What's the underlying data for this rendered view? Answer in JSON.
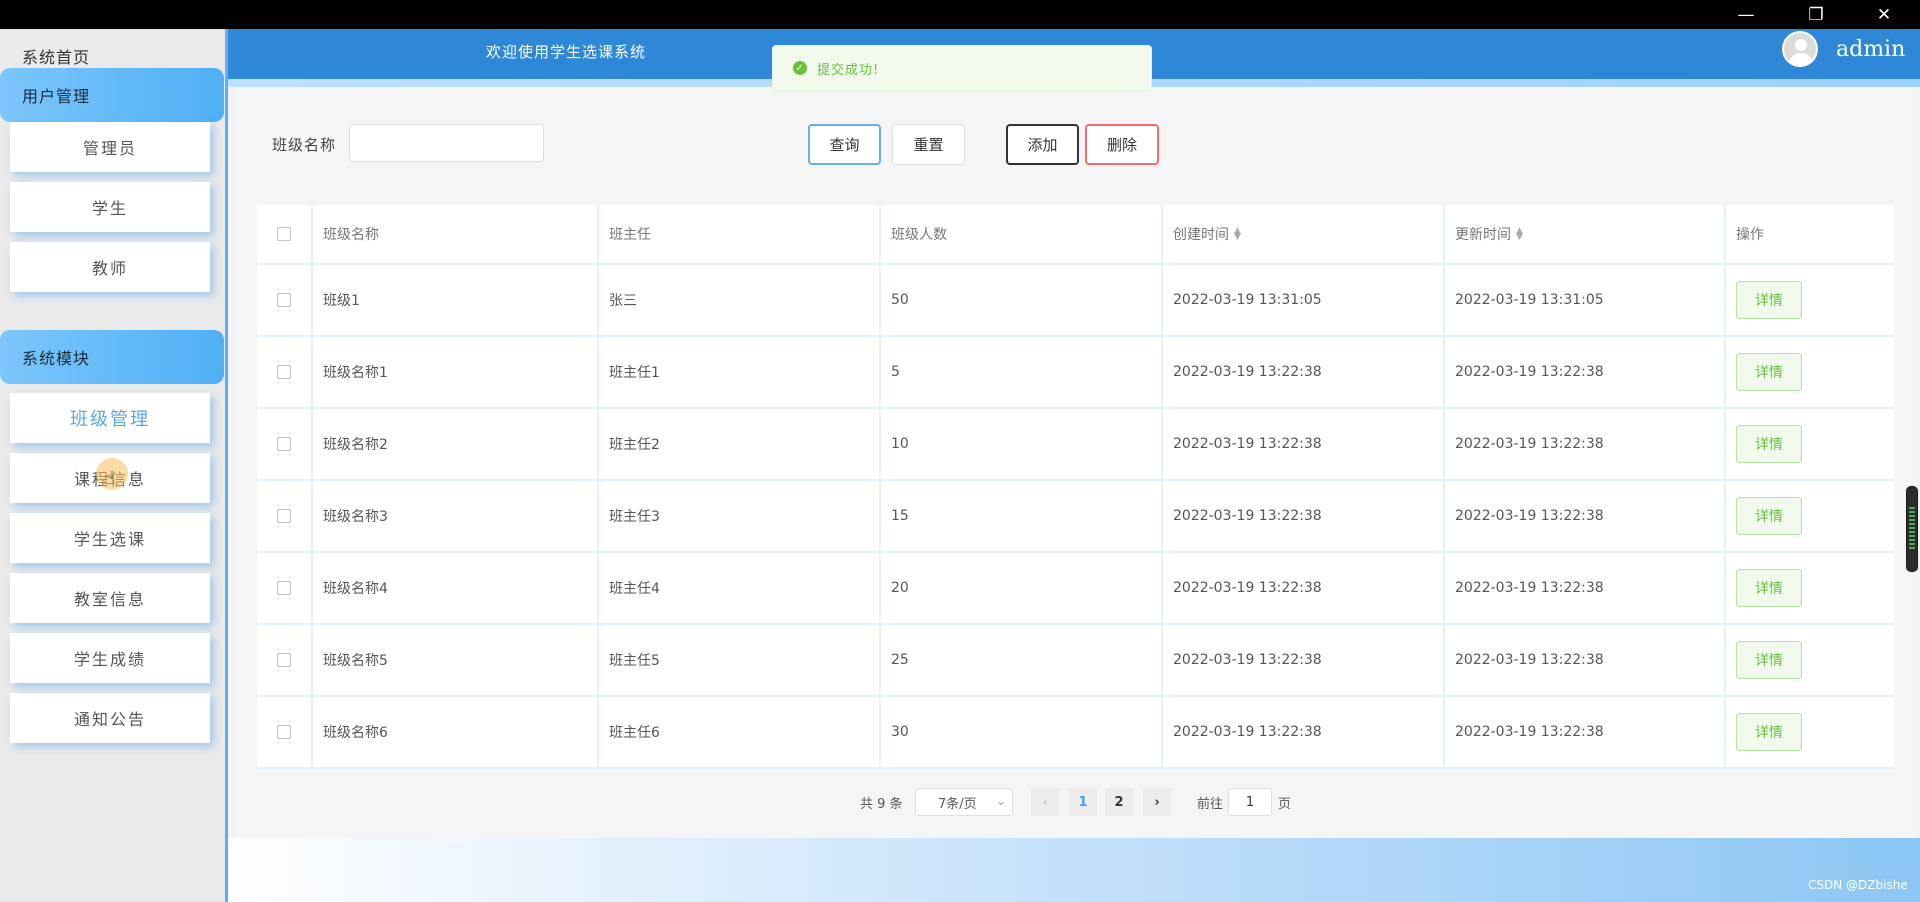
{
  "window": {
    "min": "—",
    "max": "❐",
    "close": "✕"
  },
  "sidebar": {
    "home": "系统首页",
    "groups": [
      {
        "label": "用户管理",
        "items": [
          "管理员",
          "学生",
          "教师"
        ]
      },
      {
        "label": "系统模块",
        "items": [
          "班级管理",
          "课程信息",
          "学生选课",
          "教室信息",
          "学生成绩",
          "通知公告"
        ]
      }
    ],
    "active_item": "班级管理"
  },
  "header": {
    "welcome": "欢迎使用学生选课系统",
    "username": "admin"
  },
  "toast": {
    "message": "提交成功!",
    "type": "success"
  },
  "filter": {
    "label": "班级名称",
    "value": ""
  },
  "buttons": {
    "query": "查询",
    "reset": "重置",
    "add": "添加",
    "delete": "删除"
  },
  "table": {
    "headers": [
      "班级名称",
      "班主任",
      "班级人数",
      "创建时间",
      "更新时间",
      "操作"
    ],
    "rows": [
      {
        "name": "班级1",
        "teacher": "张三",
        "count": "50",
        "created": "2022-03-19 13:31:05",
        "updated": "2022-03-19 13:31:05"
      },
      {
        "name": "班级名称1",
        "teacher": "班主任1",
        "count": "5",
        "created": "2022-03-19 13:22:38",
        "updated": "2022-03-19 13:22:38"
      },
      {
        "name": "班级名称2",
        "teacher": "班主任2",
        "count": "10",
        "created": "2022-03-19 13:22:38",
        "updated": "2022-03-19 13:22:38"
      },
      {
        "name": "班级名称3",
        "teacher": "班主任3",
        "count": "15",
        "created": "2022-03-19 13:22:38",
        "updated": "2022-03-19 13:22:38"
      },
      {
        "name": "班级名称4",
        "teacher": "班主任4",
        "count": "20",
        "created": "2022-03-19 13:22:38",
        "updated": "2022-03-19 13:22:38"
      },
      {
        "name": "班级名称5",
        "teacher": "班主任5",
        "count": "25",
        "created": "2022-03-19 13:22:38",
        "updated": "2022-03-19 13:22:38"
      },
      {
        "name": "班级名称6",
        "teacher": "班主任6",
        "count": "30",
        "created": "2022-03-19 13:22:38",
        "updated": "2022-03-19 13:22:38"
      }
    ],
    "action_label": "详情"
  },
  "pagination": {
    "total": "共 9 条",
    "page_size": "7条/页",
    "prev": "‹",
    "pages": [
      "1",
      "2"
    ],
    "current": "1",
    "next": "›",
    "goto_label": "前往",
    "goto_value": "1",
    "goto_suffix": "页"
  },
  "watermark": "CSDN @DZbishe",
  "colors": {
    "header": "#2e87d7",
    "sidebar_group": "#4fb0f5",
    "success": "#67c23a",
    "danger": "#f56c6c"
  }
}
